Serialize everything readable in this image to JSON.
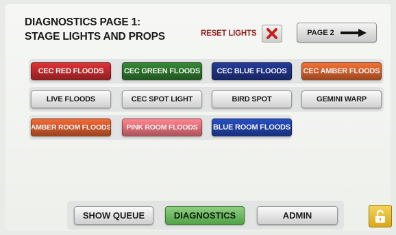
{
  "header": {
    "title_line1": "DIAGNOSTICS PAGE 1:",
    "title_line2": "STAGE LIGHTS AND PROPS",
    "reset_label": "RESET LIGHTS",
    "reset_icon": "x-mark-icon",
    "page2_label": "PAGE 2",
    "page2_icon": "right-arrow-icon"
  },
  "grid": {
    "rows": [
      [
        {
          "label": "CEC RED FLOODS",
          "color": "#b3282b"
        },
        {
          "label": "CEC GREEN FLOODS",
          "color": "#2b6d2b"
        },
        {
          "label": "CEC BLUE FLOODS",
          "color": "#1d2f7a"
        },
        {
          "label": "CEC AMBER FLOODS",
          "color": "#c45a2a"
        }
      ],
      [
        {
          "label": "LIVE FLOODS"
        },
        {
          "label": "CEC SPOT LIGHT"
        },
        {
          "label": "BIRD SPOT"
        },
        {
          "label": "GEMINI WARP"
        }
      ],
      [
        {
          "label": "AMBER ROOM FLOODS",
          "color": "#c4552a"
        },
        {
          "label": "PINK ROOM FLOODS",
          "color": "#d66a72"
        },
        {
          "label": "BLUE ROOM FLOODS",
          "color": "#1f3f9c"
        }
      ]
    ]
  },
  "nav": {
    "show_queue": "SHOW QUEUE",
    "diagnostics": "DIAGNOSTICS",
    "admin": "ADMIN",
    "active": "diagnostics"
  },
  "lock": {
    "icon": "unlocked-padlock-icon",
    "color": "#e8bf2a"
  }
}
